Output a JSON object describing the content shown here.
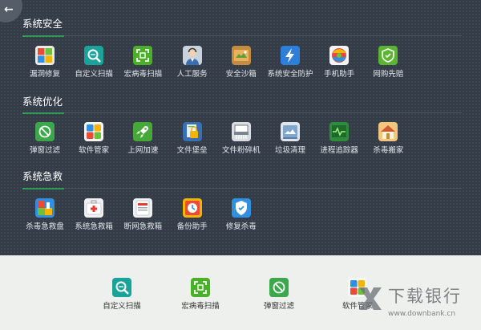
{
  "nav": {
    "back_icon": "←"
  },
  "sections": [
    {
      "title": "系统安全",
      "items": [
        {
          "label": "漏洞修复",
          "icon": "windows-shield-icon"
        },
        {
          "label": "自定义扫描",
          "icon": "magnifier-icon"
        },
        {
          "label": "宏病毒扫描",
          "icon": "scan-frame-icon"
        },
        {
          "label": "人工服务",
          "icon": "service-person-icon"
        },
        {
          "label": "安全沙箱",
          "icon": "sandbox-icon"
        },
        {
          "label": "系统安全防护",
          "icon": "lightning-icon"
        },
        {
          "label": "手机助手",
          "icon": "phone-ball-icon"
        },
        {
          "label": "网购先赔",
          "icon": "shield-icon"
        }
      ]
    },
    {
      "title": "系统优化",
      "items": [
        {
          "label": "弹窗过滤",
          "icon": "block-popup-icon"
        },
        {
          "label": "软件管家",
          "icon": "software-grid-icon"
        },
        {
          "label": "上网加速",
          "icon": "rocket-icon"
        },
        {
          "label": "文件堡垒",
          "icon": "file-lock-icon"
        },
        {
          "label": "文件粉碎机",
          "icon": "shredder-icon"
        },
        {
          "label": "垃圾清理",
          "icon": "cleanup-icon"
        },
        {
          "label": "进程追踪器",
          "icon": "pulse-monitor-icon"
        },
        {
          "label": "杀毒搬家",
          "icon": "house-move-icon"
        }
      ]
    },
    {
      "title": "系统急救",
      "items": [
        {
          "label": "杀毒急救盘",
          "icon": "rescue-usb-icon"
        },
        {
          "label": "系统急救箱",
          "icon": "first-aid-kit-icon"
        },
        {
          "label": "断网急救箱",
          "icon": "network-aid-icon"
        },
        {
          "label": "备份助手",
          "icon": "backup-clock-icon"
        },
        {
          "label": "修复杀毒",
          "icon": "repair-shield-icon"
        }
      ]
    }
  ],
  "quick": [
    {
      "label": "自定义扫描",
      "icon": "magnifier-icon"
    },
    {
      "label": "宏病毒扫描",
      "icon": "scan-frame-icon"
    },
    {
      "label": "弹窗过滤",
      "icon": "block-popup-icon"
    },
    {
      "label": "软件管家",
      "icon": "software-grid-icon"
    }
  ],
  "watermark": {
    "name": "下载银行",
    "url": "www.downbank.cn"
  },
  "colors": {
    "panel_bg": "#343c48",
    "accent_green": "#2e9e56",
    "bottom_bg": "#eef0ee"
  }
}
